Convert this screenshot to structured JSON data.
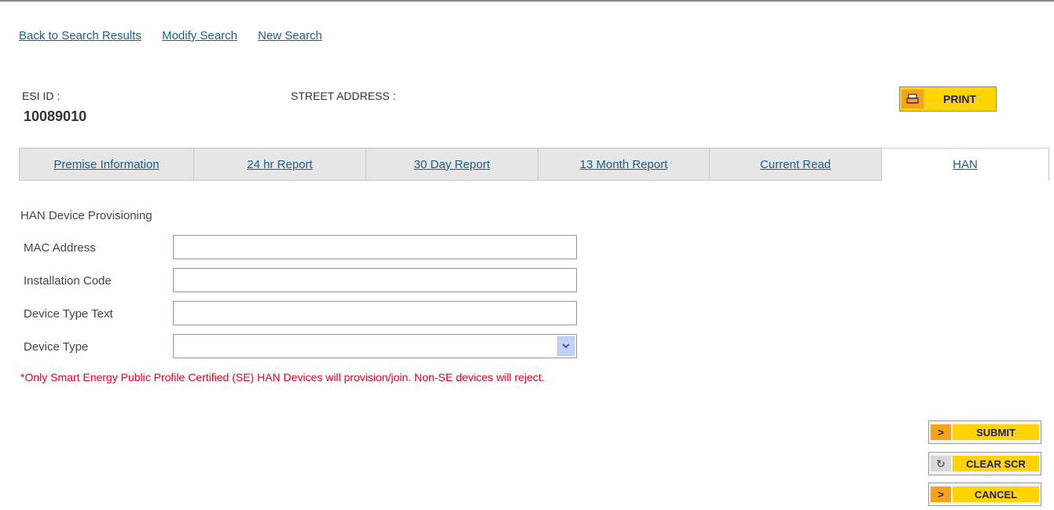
{
  "nav": {
    "back_to_results": "Back to Search Results",
    "modify_search": "Modify Search",
    "new_search": "New Search"
  },
  "header": {
    "esi_id_label": "ESI ID :",
    "esi_id_value": "10089010",
    "street_address_label": "STREET ADDRESS :",
    "print_label": "PRINT"
  },
  "tabs": [
    {
      "label": "Premise Information"
    },
    {
      "label": "24 hr Report"
    },
    {
      "label": "30 Day Report"
    },
    {
      "label": "13 Month Report"
    },
    {
      "label": "Current Read"
    },
    {
      "label": "HAN",
      "active": true
    }
  ],
  "form": {
    "title": "HAN Device Provisioning",
    "mac_address_label": "MAC Address",
    "mac_address_value": "",
    "installation_code_label": "Installation Code",
    "installation_code_value": "",
    "device_type_text_label": "Device Type Text",
    "device_type_text_value": "",
    "device_type_label": "Device Type",
    "device_type_value": "",
    "note": "*Only Smart Energy Public Profile Certified (SE) HAN Devices will provision/join. Non-SE devices will reject."
  },
  "actions": {
    "submit_label": "SUBMIT",
    "clear_label": "CLEAR SCR",
    "cancel_label": "CANCEL"
  },
  "colors": {
    "link": "#1a5e91",
    "button_yellow": "#ffd400",
    "button_orange": "#f6a21a",
    "warning_red": "#e8001c"
  }
}
